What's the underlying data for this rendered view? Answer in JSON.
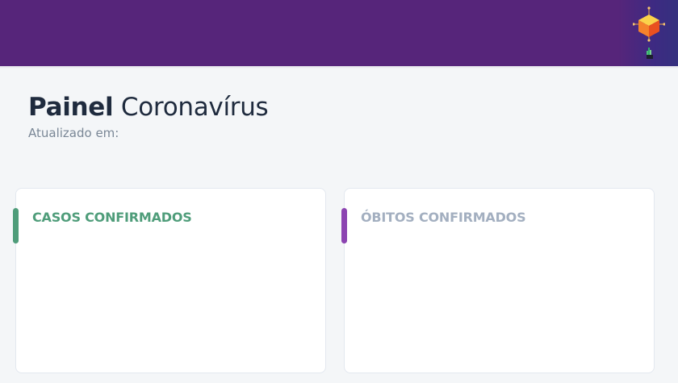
{
  "header": {
    "logo_icon": "cube-logo-icon",
    "badge_icon": "small-badge-icon",
    "colors": {
      "background": "#56257a"
    }
  },
  "page": {
    "title_bold": "Painel",
    "title_regular": "Coronavírus",
    "updated_label": "Atualizado em:"
  },
  "cards": {
    "confirmed": {
      "title": "CASOS CONFIRMADOS",
      "accent_color": "#4f9d7a"
    },
    "deaths": {
      "title": "ÓBITOS CONFIRMADOS",
      "accent_color": "#8c44b1"
    }
  }
}
